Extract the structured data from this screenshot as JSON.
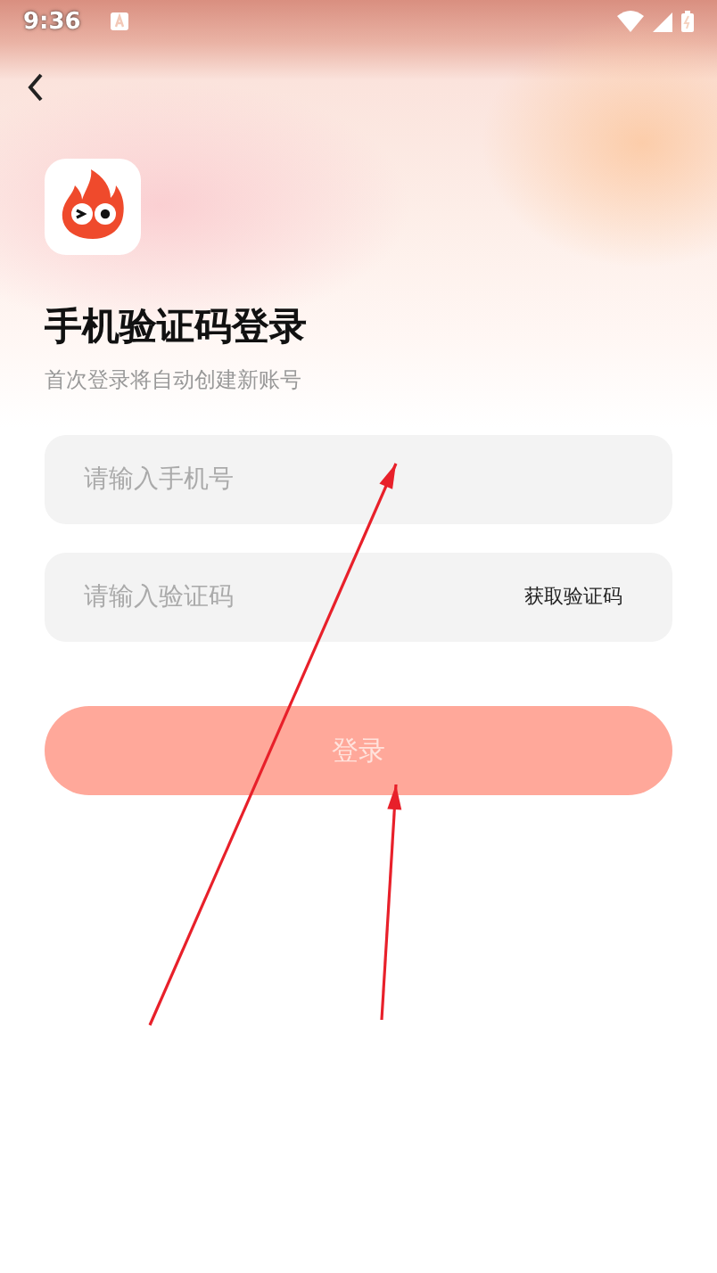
{
  "status_bar": {
    "time": "9:36"
  },
  "title": "手机验证码登录",
  "subtitle": "首次登录将自动创建新账号",
  "phone_field": {
    "placeholder": "请输入手机号"
  },
  "code_field": {
    "placeholder": "请输入验证码",
    "action": "获取验证码"
  },
  "login_button": {
    "label": "登录",
    "disabled": true
  },
  "annotations": [
    {
      "kind": "arrow"
    },
    {
      "kind": "arrow"
    }
  ]
}
